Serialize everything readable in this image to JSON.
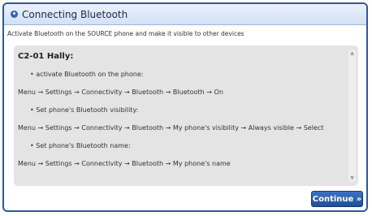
{
  "dialog": {
    "title": "Connecting Bluetooth",
    "instruction": "Activate Bluetooth on the SOURCE phone and make it visible to other devices",
    "continue_label": "Continue »"
  },
  "content": {
    "model": "C2-01 Hally:",
    "steps": [
      {
        "bullet": "• activate Bluetooth on the phone:",
        "path": "Menu → Settings → Connectivity → Bluetooth → Bluetooth → On"
      },
      {
        "bullet": "• Set phone's Bluetooth visibility:",
        "path": "Menu → Settings → Connectivity → Bluetooth → My phone's visibility → Always visible → Select"
      },
      {
        "bullet": "• Set phone's Bluetooth name:",
        "path": "Menu → Settings → Connectivity → Bluetooth → My phone's name"
      }
    ]
  },
  "icons": {
    "title": "info-bullet-icon",
    "scroll_up": "scroll-up-arrow-icon",
    "scroll_down": "scroll-down-arrow-icon"
  },
  "colors": {
    "accent": "#2a5a9c",
    "button": "#2b5fab",
    "panel": "#e4e4e4"
  }
}
